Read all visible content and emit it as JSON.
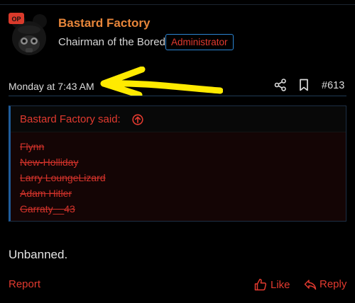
{
  "author": {
    "name": "Bastard Factory",
    "title": "Chairman of the Bored",
    "role": "Administrator",
    "avatar_badge": "OP",
    "avatar_icon": "skull-with-gasmask-and-mouse-ears"
  },
  "post": {
    "date": "Monday at 7:43 AM",
    "number": "#613",
    "message": "Unbanned."
  },
  "quote": {
    "author_line": "Bastard Factory said:",
    "lines": [
      "Flynn",
      "New-Holliday",
      "Larry LoungeLizard",
      "Adam Hitler",
      "Garraty__43"
    ]
  },
  "actions": {
    "report": "Report",
    "like": "Like",
    "reply": "Reply"
  },
  "colors": {
    "accent_red": "#e23a2f",
    "name_orange": "#e8863a",
    "badge_border_blue": "#2b84d2",
    "annotation_arrow_yellow": "#ffea00"
  },
  "icons": [
    "share-icon",
    "bookmark-icon",
    "arrow-circle-up-icon",
    "thumbs-up-icon",
    "reply-arrow-icon"
  ]
}
